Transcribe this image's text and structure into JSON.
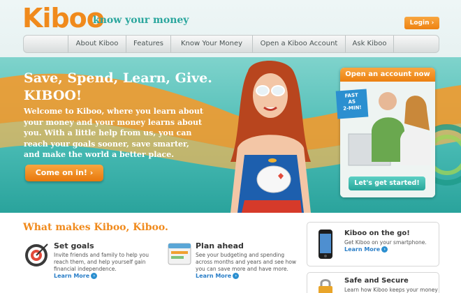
{
  "header": {
    "logo": "Kiboo",
    "tagline": "know your money",
    "login_label": "Login ›"
  },
  "nav": {
    "items": [
      {
        "label": "About Kiboo"
      },
      {
        "label": "Features"
      },
      {
        "label": "Know Your Money"
      },
      {
        "label": "Open a Kiboo Account"
      },
      {
        "label": "Ask Kiboo"
      }
    ]
  },
  "hero": {
    "headline_line1": "Save, Spend, Learn, Give.",
    "headline_line2": "KIBOO!",
    "intro_lines": [
      "Welcome to Kiboo, where you learn about",
      "your money and your money learns about",
      "you. With a little help from us, you can",
      "reach your goals sooner, save smarter,",
      "and make the world a better place."
    ],
    "cta_label": "Come on in!  ›"
  },
  "account_card": {
    "title": "Open an account now",
    "badge_lines": [
      "FAST",
      "AS",
      "2-MIN!"
    ],
    "button_label": "Let's get started!"
  },
  "features": {
    "title": "What makes Kiboo, Kiboo.",
    "items": [
      {
        "name": "Set goals",
        "lines": [
          "Invite friends and family to help you",
          "reach them, and help yourself gain",
          "financial independence."
        ],
        "learn_more": "Learn More"
      },
      {
        "name": "Plan ahead",
        "lines": [
          "See your budgeting and spending",
          "across months and years and see how",
          "you can save more and have more."
        ],
        "learn_more": "Learn More"
      }
    ]
  },
  "sidebar": {
    "boxes": [
      {
        "title": "Kiboo on the go!",
        "text": "Get Kiboo on your smartphone.",
        "learn_more": "Learn More"
      },
      {
        "title": "Safe and Secure",
        "text": "Learn how Kiboo keeps your money"
      }
    ]
  },
  "colors": {
    "brand_orange": "#f08a1c",
    "brand_teal": "#2aa69d",
    "link_blue": "#2b7fc8"
  }
}
